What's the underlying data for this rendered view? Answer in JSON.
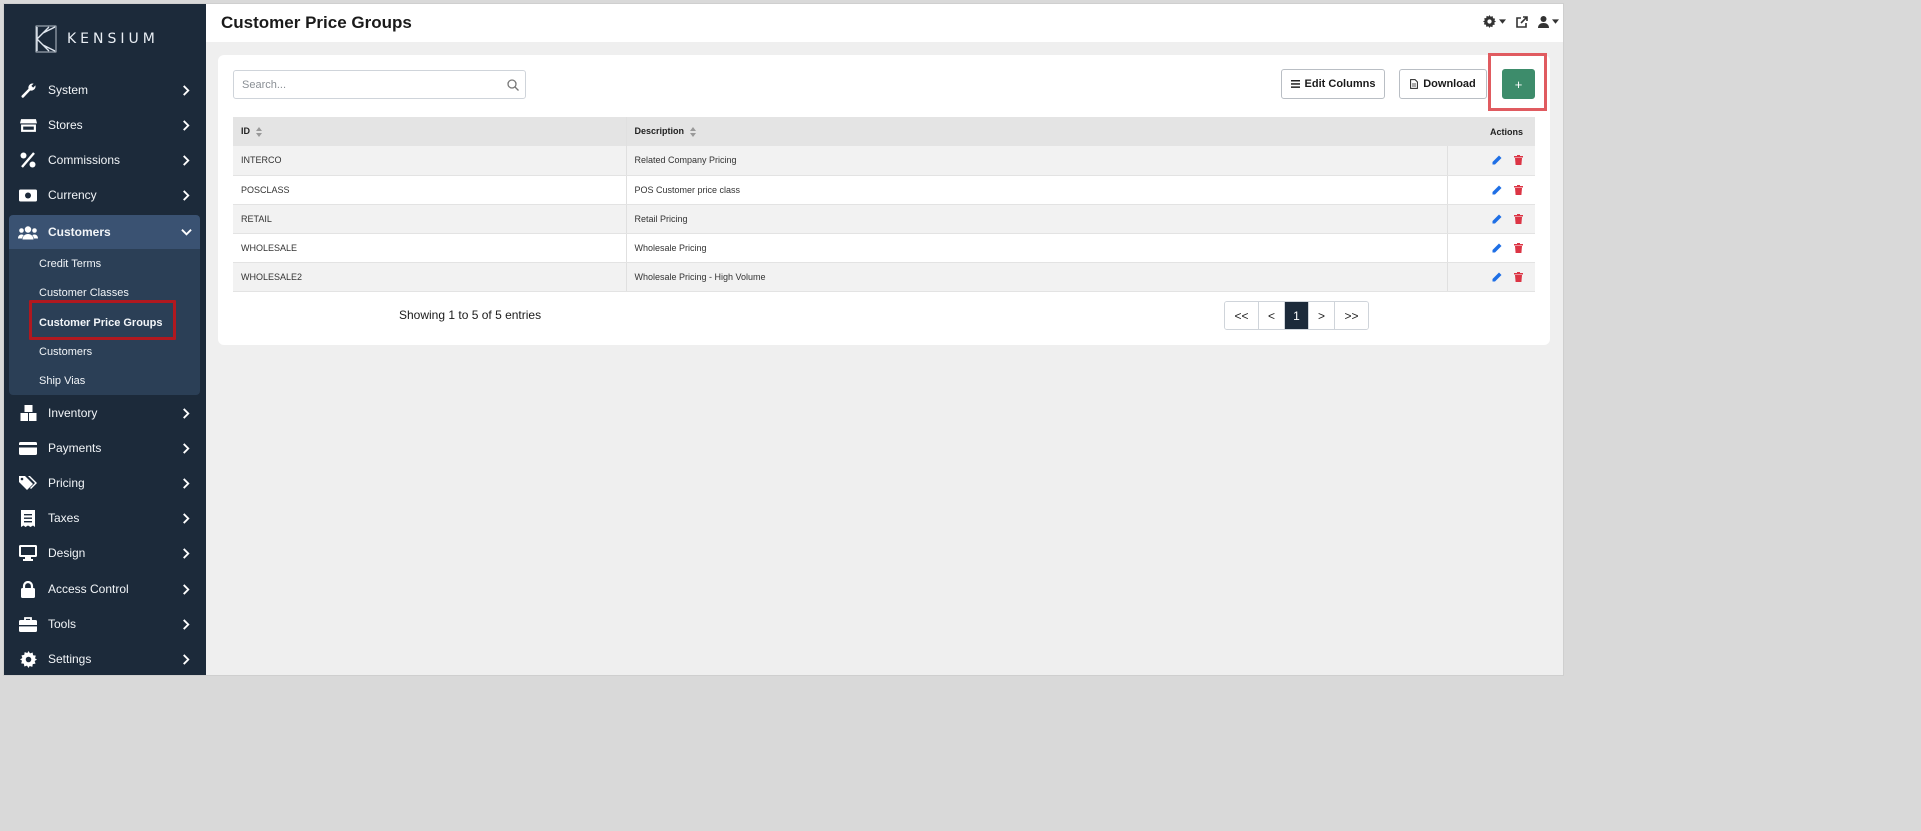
{
  "app": {
    "brand": "KENSIUM"
  },
  "header": {
    "title": "Customer Price Groups"
  },
  "sidebar": {
    "items": [
      {
        "label": "System",
        "icon": "wrench-icon"
      },
      {
        "label": "Stores",
        "icon": "store-icon"
      },
      {
        "label": "Commissions",
        "icon": "percent-icon"
      },
      {
        "label": "Currency",
        "icon": "money-bill-icon"
      },
      {
        "label": "Customers",
        "icon": "users-icon",
        "expanded": true
      },
      {
        "label": "Inventory",
        "icon": "boxes-icon"
      },
      {
        "label": "Payments",
        "icon": "credit-card-icon"
      },
      {
        "label": "Pricing",
        "icon": "tags-icon"
      },
      {
        "label": "Taxes",
        "icon": "receipt-icon"
      },
      {
        "label": "Design",
        "icon": "desktop-icon"
      },
      {
        "label": "Access Control",
        "icon": "lock-icon"
      },
      {
        "label": "Tools",
        "icon": "toolbox-icon"
      },
      {
        "label": "Settings",
        "icon": "cog-icon"
      }
    ],
    "customers_submenu": [
      {
        "label": "Credit Terms"
      },
      {
        "label": "Customer Classes"
      },
      {
        "label": "Customer Price Groups",
        "selected": true
      },
      {
        "label": "Customers"
      },
      {
        "label": "Ship Vias"
      }
    ]
  },
  "toolbar": {
    "search_placeholder": "Search...",
    "edit_columns_label": "Edit Columns",
    "download_label": "Download",
    "add_label": "+"
  },
  "table": {
    "columns": [
      "ID",
      "Description",
      "Actions"
    ],
    "rows": [
      {
        "id": "INTERCO",
        "description": "Related Company Pricing"
      },
      {
        "id": "POSCLASS",
        "description": "POS Customer price class"
      },
      {
        "id": "RETAIL",
        "description": "Retail Pricing"
      },
      {
        "id": "WHOLESALE",
        "description": "Wholesale Pricing"
      },
      {
        "id": "WHOLESALE2",
        "description": "Wholesale Pricing - High Volume"
      }
    ]
  },
  "pagination": {
    "summary": "Showing 1 to 5 of 5 entries",
    "first": "<<",
    "prev": "<",
    "current": "1",
    "next": ">",
    "last": ">>"
  },
  "colors": {
    "sidebar_bg": "#1c2a3a",
    "active_item_bg": "#3a5272",
    "submenu_bg": "#2b3f56",
    "add_button": "#3d8c6b",
    "edit_icon": "#1f6fe5",
    "delete_icon": "#dc3545",
    "highlight_red": "#e05b60"
  }
}
